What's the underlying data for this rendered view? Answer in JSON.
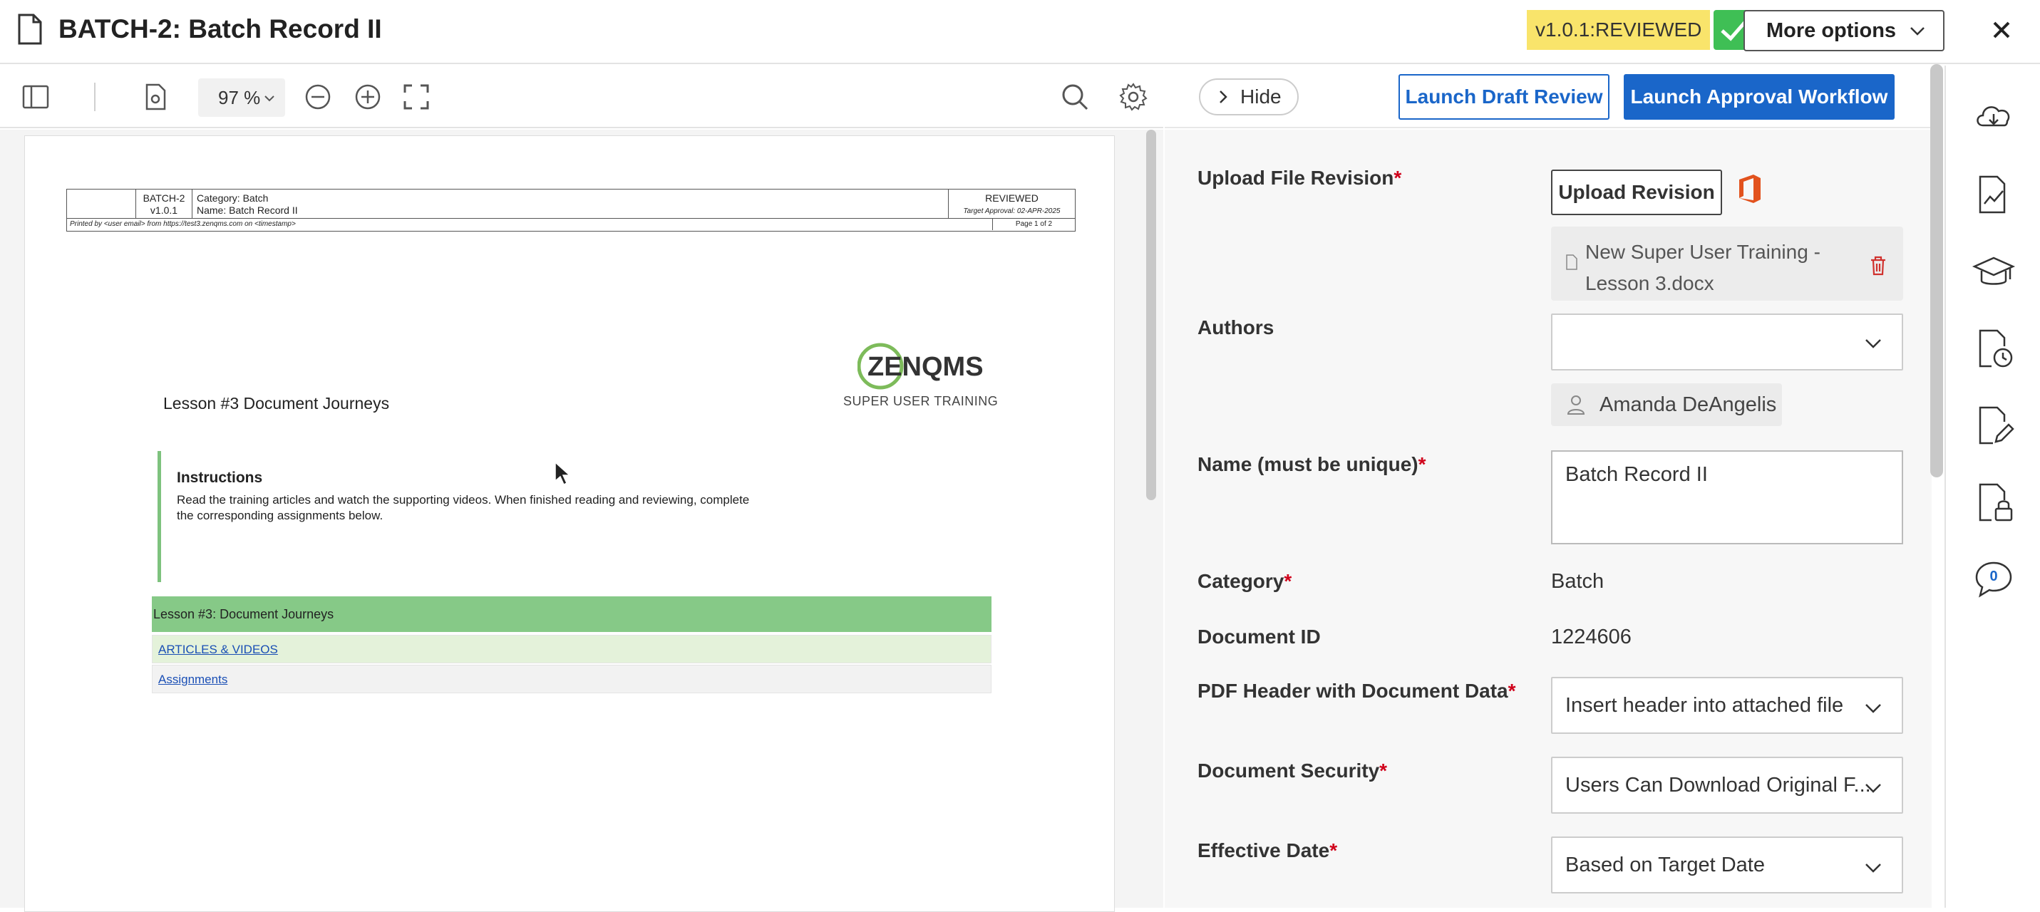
{
  "window": {
    "title": "BATCH-2: Batch Record II",
    "version_badge": "v1.0.1:REVIEWED",
    "more_options_label": "More options"
  },
  "toolbar": {
    "zoom_level": "97 %"
  },
  "document": {
    "header": {
      "doc_id": "BATCH-2",
      "version": "v1.0.1",
      "category_line": "Category: Batch",
      "name_line": "Name: Batch Record II",
      "status": "REVIEWED",
      "target_approval": "Target Approval: 02-APR-2025",
      "printed_by": "Printed by <user email> from https://test3.zenqms.com on <timestamp>",
      "page_of": "Page 1 of 2"
    },
    "logo_text": "ZENQMS",
    "logo_sub": "SUPER USER TRAINING",
    "lesson_title": "Lesson #3 Document Journeys",
    "instructions_heading": "Instructions",
    "instructions_text": "Read the training articles and watch the supporting videos. When finished reading and reviewing, complete the corresponding assignments below.",
    "green_bar": "Lesson #3: Document Journeys",
    "link_articles": "ARTICLES & VIDEOS",
    "link_assignments": "Assignments"
  },
  "panel": {
    "hide_label": "Hide",
    "draft_review_label": "Launch Draft Review",
    "approval_label": "Launch Approval Workflow"
  },
  "form": {
    "upload_label": "Upload File Revision",
    "upload_button": "Upload Revision",
    "file_name": "New Super User Training - Lesson 3.docx",
    "authors_label": "Authors",
    "author_chip": "Amanda DeAngelis",
    "name_label": "Name (must be unique)",
    "name_value": "Batch Record II",
    "category_label": "Category",
    "category_value": "Batch",
    "docid_label": "Document ID",
    "docid_value": "1224606",
    "pdf_header_label": "PDF Header with Document Data",
    "pdf_header_value": "Insert header into attached file",
    "security_label": "Document Security",
    "security_value": "Users Can Download Original F...",
    "effective_label": "Effective Date",
    "effective_value": "Based on Target Date",
    "required_mark": "*"
  },
  "rail": {
    "comments_count": "0"
  },
  "colors": {
    "primary": "#1a66c9",
    "badge": "#f9e46b",
    "check": "#3fbf55",
    "required": "#d0021b",
    "doc_green": "#86c987"
  }
}
